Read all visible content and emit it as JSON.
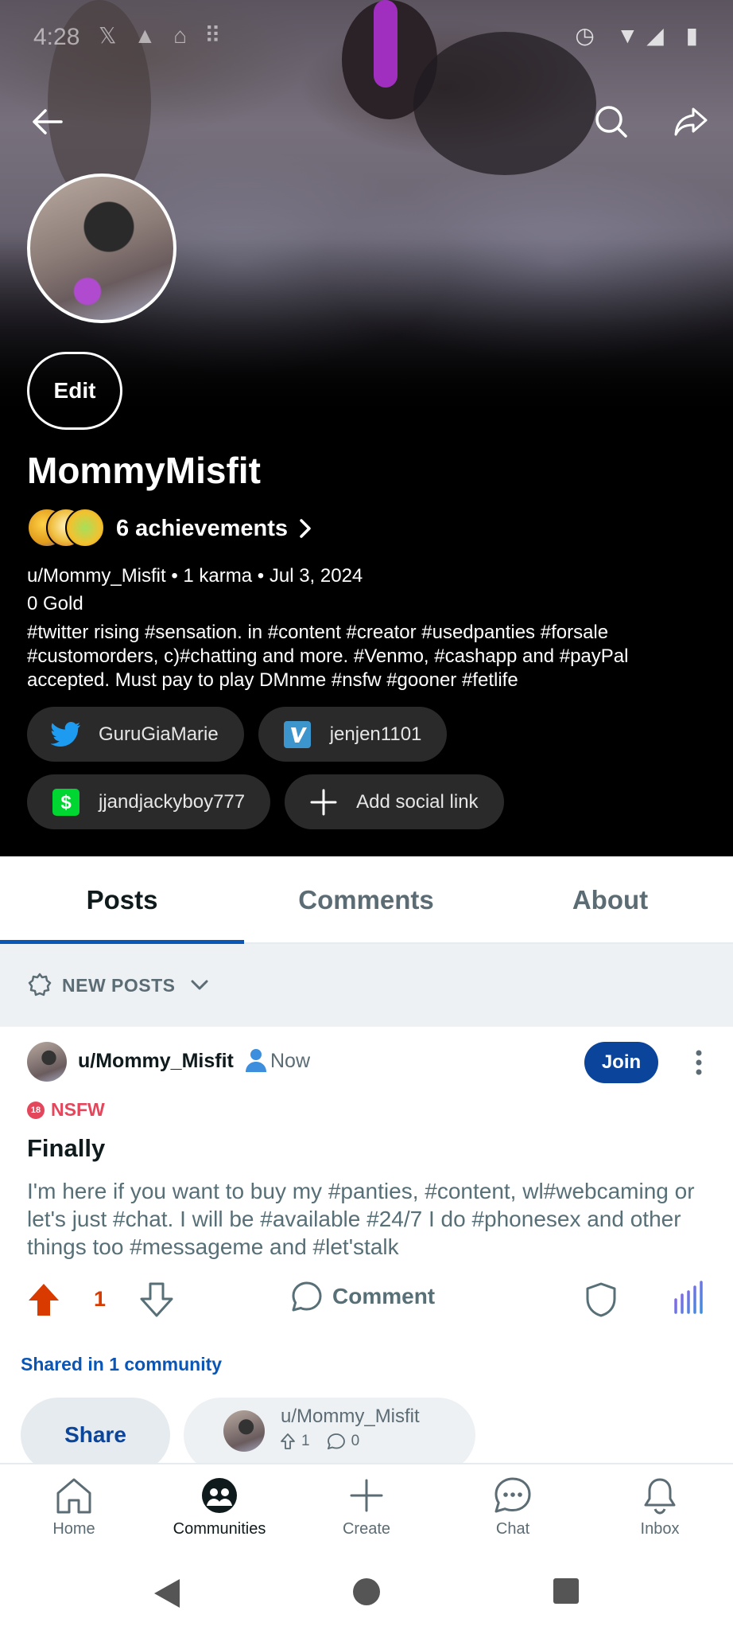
{
  "status_bar": {
    "time": "4:28"
  },
  "profile": {
    "display_name": "MommyMisfit",
    "edit_label": "Edit",
    "achievements_label": "6 achievements",
    "meta": "u/Mommy_Misfit • 1 karma • Jul 3, 2024",
    "gold": "0 Gold",
    "bio": "#twitter rising #sensation. in #content #creator #usedpanties #forsale #customorders, c)#chatting and more. #Venmo, #cashapp and #payPal accepted. Must pay to play DMnme #nsfw #gooner #fetlife",
    "social_links": [
      {
        "label": "GuruGiaMarie",
        "icon": "twitter-icon",
        "color": "#1d9bf0"
      },
      {
        "label": "jenjen1101",
        "icon": "venmo-icon",
        "color": "#3d95ce"
      },
      {
        "label": "jjandjackyboy777",
        "icon": "cashapp-icon",
        "color": "#00d632"
      },
      {
        "label": "Add social link",
        "icon": "plus-icon",
        "color": "#ffffff"
      }
    ]
  },
  "tabs": [
    {
      "label": "Posts",
      "active": true
    },
    {
      "label": "Comments",
      "active": false
    },
    {
      "label": "About",
      "active": false
    }
  ],
  "sort": {
    "label": "NEW POSTS"
  },
  "post": {
    "author": "u/Mommy_Misfit",
    "time": "Now",
    "join_label": "Join",
    "nsfw_label": "NSFW",
    "nsfw_badge": "18",
    "title": "Finally",
    "body": "I'm here if you want to buy my #panties, #content, wl#webcaming   or let's just #chat. I will be #available #24/7 I do #phonesex and other things too #messageme and #let'stalk",
    "vote_count": "1",
    "comment_label": "Comment",
    "shared_label": "Shared in 1 community",
    "share_label": "Share",
    "crosspost": {
      "author": "u/Mommy_Misfit",
      "upvotes": "1",
      "comments": "0"
    }
  },
  "bottom_nav": [
    {
      "label": "Home",
      "icon": "home-icon"
    },
    {
      "label": "Communities",
      "icon": "communities-icon",
      "active": true
    },
    {
      "label": "Create",
      "icon": "plus-icon"
    },
    {
      "label": "Chat",
      "icon": "chat-icon"
    },
    {
      "label": "Inbox",
      "icon": "bell-icon"
    }
  ],
  "colors": {
    "accent_blue": "#0a449b",
    "link_blue": "#0a56b6",
    "upvote_orange": "#d93a00",
    "nsfw_red": "#e4475b"
  }
}
